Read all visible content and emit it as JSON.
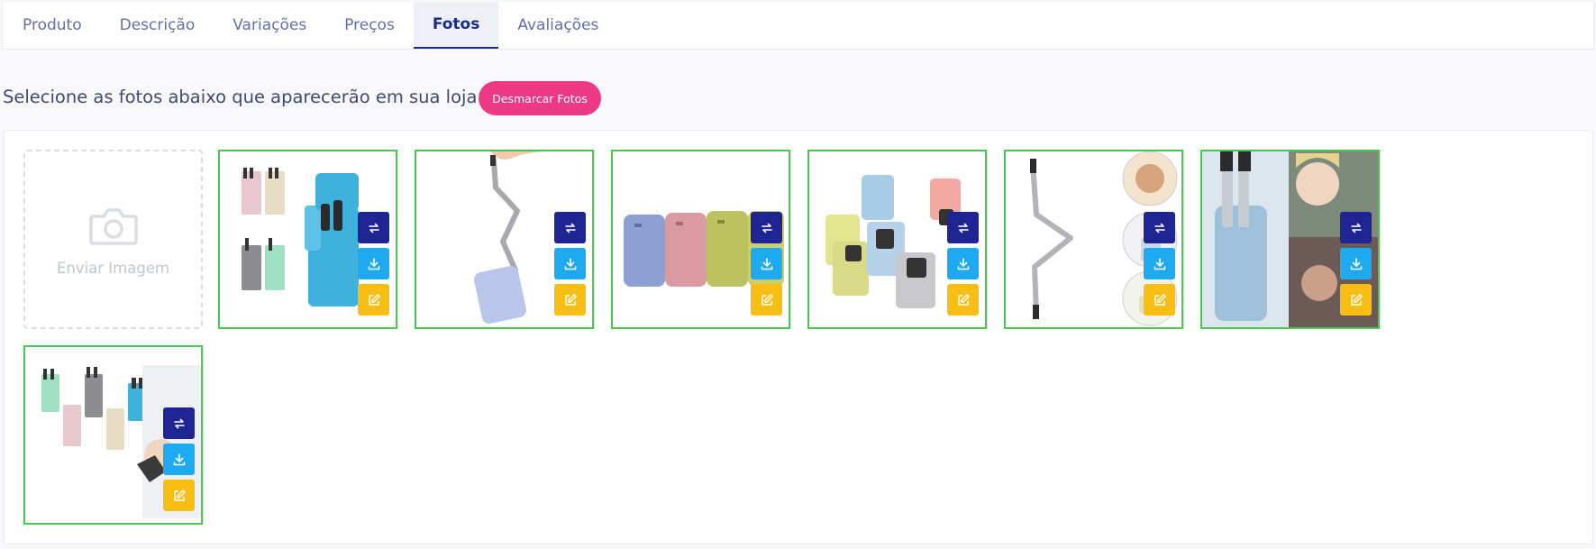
{
  "tabs": [
    {
      "label": "Produto",
      "active": false
    },
    {
      "label": "Descrição",
      "active": false
    },
    {
      "label": "Variações",
      "active": false
    },
    {
      "label": "Preços",
      "active": false
    },
    {
      "label": "Fotos",
      "active": true
    },
    {
      "label": "Avaliações",
      "active": false
    }
  ],
  "photos_section": {
    "heading": "Selecione as fotos abaixo que aparecerão em sua loja",
    "unselect_button": "Desmarcar Fotos",
    "upload_label": "Enviar Imagem",
    "photos": [
      {
        "selected": true,
        "content": "folding-straws-in-cases"
      },
      {
        "selected": true,
        "content": "hand-holding-folding-straw"
      },
      {
        "selected": true,
        "content": "three-pastel-straw-cases"
      },
      {
        "selected": true,
        "content": "open-straw-cases-assorted"
      },
      {
        "selected": true,
        "content": "straw-with-usage-circles"
      },
      {
        "selected": true,
        "content": "straw-case-and-person-collage"
      },
      {
        "selected": true,
        "content": "assorted-colored-straw-sets"
      }
    ]
  },
  "colors": {
    "active_tab": "#1b2a86",
    "unselect_button": "#ee3a85",
    "selected_border": "#48c84f",
    "swap_button": "#1e2592",
    "download_button": "#1eaaf0",
    "edit_button": "#f8be13"
  },
  "icons": [
    "camera-icon",
    "swap-icon",
    "download-icon",
    "edit-icon"
  ]
}
